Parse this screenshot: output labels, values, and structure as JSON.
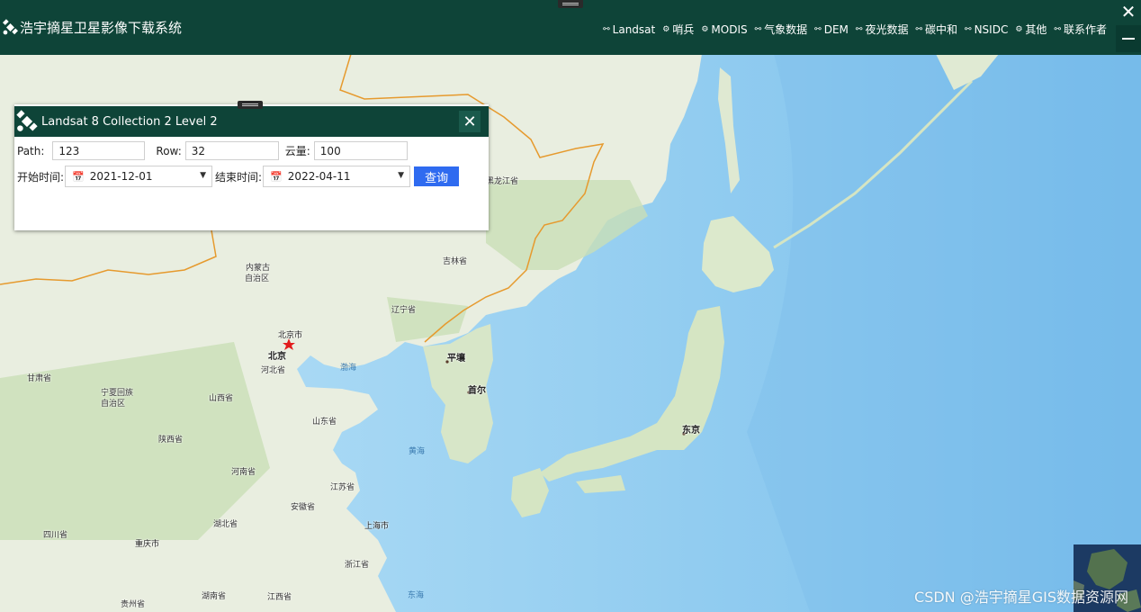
{
  "header": {
    "title": "浩宇摘星卫星影像下载系统",
    "nav": [
      {
        "icon": "share-nodes-icon",
        "label": "Landsat"
      },
      {
        "icon": "gear-icon",
        "label": "哨兵"
      },
      {
        "icon": "gear-icon",
        "label": "MODIS"
      },
      {
        "icon": "share-nodes-icon",
        "label": "气象数据"
      },
      {
        "icon": "share-nodes-icon",
        "label": "DEM"
      },
      {
        "icon": "share-nodes-icon",
        "label": "夜光数据"
      },
      {
        "icon": "share-nodes-icon",
        "label": "碳中和"
      },
      {
        "icon": "share-nodes-icon",
        "label": "NSIDC"
      },
      {
        "icon": "gear-icon",
        "label": "其他"
      },
      {
        "icon": "share-nodes-icon",
        "label": "联系作者"
      }
    ],
    "close_symbol": "✕"
  },
  "dialog": {
    "title": "Landsat 8 Collection 2 Level 2",
    "close_symbol": "✕",
    "path_label": "Path:",
    "path_value": "123",
    "row_label": "Row:",
    "row_value": "32",
    "cloud_label": "云量:",
    "cloud_value": "100",
    "start_label": "开始时间:",
    "start_value": "2021-12-01",
    "end_label": "结束时间:",
    "end_value": "2022-04-11",
    "query_label": "查询"
  },
  "map": {
    "labels": [
      "内蒙古",
      "自治区",
      "黑龙江省",
      "吉林省",
      "辽宁省",
      "北京市",
      "北京",
      "河北省",
      "甘肃省",
      "宁夏回族",
      "自治区",
      "山西省",
      "陕西省",
      "山东省",
      "渤海",
      "平壤",
      "首尔",
      "东京",
      "黄海",
      "河南省",
      "江苏省",
      "安徽省",
      "上海市",
      "湖北省",
      "四川省",
      "重庆市",
      "浙江省",
      "湖南省",
      "江西省",
      "贵州省",
      "东海"
    ]
  },
  "watermark": "CSDN @浩宇摘星GIS数据资源网"
}
